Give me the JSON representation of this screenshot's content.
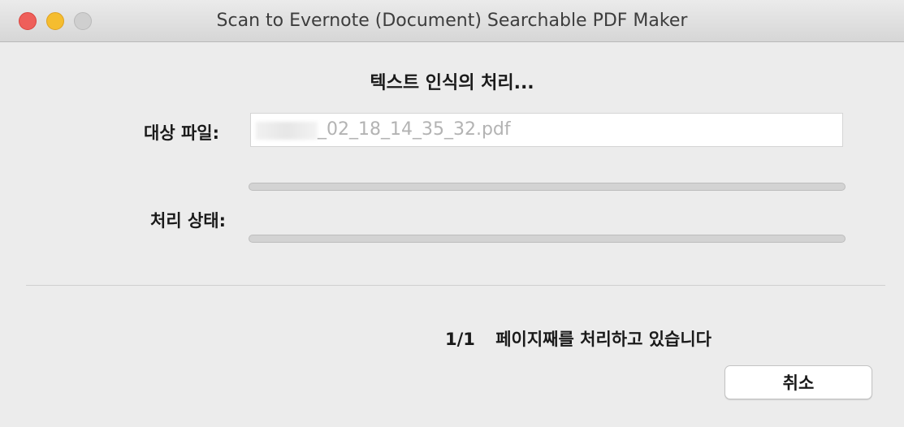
{
  "window": {
    "title": "Scan to Evernote (Document) Searchable PDF Maker"
  },
  "status_heading": "텍스트 인식의 처리...",
  "target_file": {
    "label": "대상 파일:",
    "filename": "_02_18_14_35_32.pdf"
  },
  "progress": {
    "file": 0,
    "processing": 0
  },
  "processing_status": {
    "label": "처리 상태:"
  },
  "page_status": {
    "count": "1/1",
    "text": "페이지째를 처리하고 있습니다"
  },
  "cancel_button": {
    "label": "취소"
  }
}
